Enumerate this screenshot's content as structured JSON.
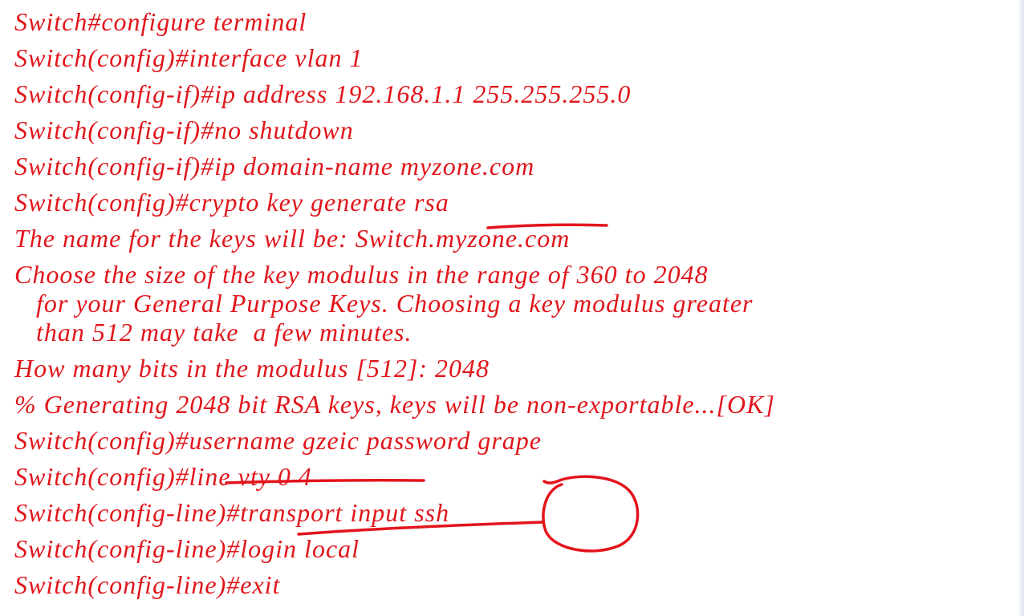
{
  "colors": {
    "text": "#e0161b",
    "ink": "#e3141c",
    "background": "#ffffff"
  },
  "lines": [
    "Switch#configure terminal",
    "Switch(config)#interface vlan 1",
    "Switch(config-if)#ip address 192.168.1.1 255.255.255.0",
    "Switch(config-if)#no shutdown",
    "Switch(config-if)#ip domain-name myzone.com",
    "Switch(config)#crypto key generate rsa",
    "The name for the keys will be: Switch.myzone.com",
    "Choose the size of the key modulus in the range of 360 to 2048",
    "   for your General Purpose Keys. Choosing a key modulus greater",
    "   than 512 may take  a few minutes.",
    "How many bits in the modulus [512]: 2048",
    "% Generating 2048 bit RSA keys, keys will be non-exportable...[OK]",
    "Switch(config)#username gzeic password grape",
    "Switch(config)#line vty 0 4",
    "Switch(config-line)#transport input ssh",
    "Switch(config-line)#login local",
    "Switch(config-line)#exit"
  ],
  "annotations": [
    {
      "name": "underline-generate-rsa",
      "kind": "underline"
    },
    {
      "name": "underline-line-vty",
      "kind": "underline"
    },
    {
      "name": "underline-transport-input",
      "kind": "underline"
    },
    {
      "name": "circle-ssh",
      "kind": "circle"
    }
  ]
}
